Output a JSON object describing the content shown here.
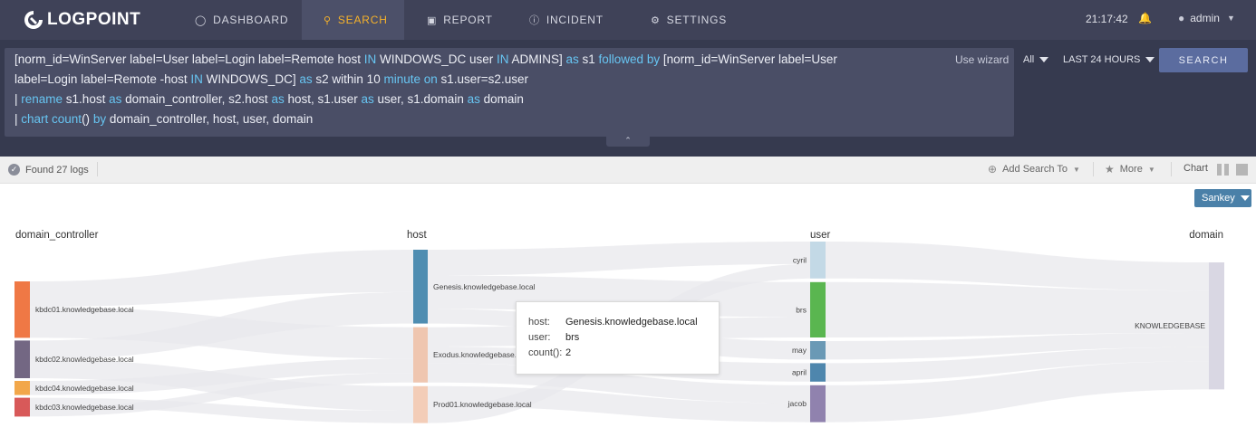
{
  "app": {
    "name": "LOGPOINT"
  },
  "nav": {
    "items": [
      {
        "label": "DASHBOARD",
        "icon": "dashboard-icon"
      },
      {
        "label": "SEARCH",
        "icon": "search-icon",
        "active": true
      },
      {
        "label": "REPORT",
        "icon": "report-icon"
      },
      {
        "label": "INCIDENT",
        "icon": "incident-icon"
      },
      {
        "label": "SETTINGS",
        "icon": "gear-icon"
      }
    ],
    "time": "21:17:42",
    "user": "admin"
  },
  "query": {
    "lines": [
      [
        [
          "[norm_id=WinServer label=User label=Login label=Remote host ",
          "t"
        ],
        [
          "IN",
          "k"
        ],
        [
          " WINDOWS_DC user ",
          "t"
        ],
        [
          "IN",
          "k"
        ],
        [
          " ADMINS] ",
          "t"
        ],
        [
          "as",
          "k"
        ],
        [
          " s1 ",
          "t"
        ],
        [
          "followed by",
          "k"
        ],
        [
          " [norm_id=WinServer label=User",
          "t"
        ]
      ],
      [
        [
          "label=Login label=Remote -host ",
          "t"
        ],
        [
          "IN",
          "k"
        ],
        [
          " WINDOWS_DC] ",
          "t"
        ],
        [
          "as",
          "k"
        ],
        [
          " s2 within 10 ",
          "t"
        ],
        [
          "minute",
          "k"
        ],
        [
          " ",
          "t"
        ],
        [
          "on",
          "k"
        ],
        [
          " s1.user=s2.user",
          "t"
        ]
      ],
      [
        [
          "| ",
          "t"
        ],
        [
          "rename",
          "k"
        ],
        [
          " s1.host ",
          "t"
        ],
        [
          "as",
          "k"
        ],
        [
          " domain_controller, s2.host ",
          "t"
        ],
        [
          "as",
          "k"
        ],
        [
          " host, s1.user ",
          "t"
        ],
        [
          "as",
          "k"
        ],
        [
          " user, s1.domain ",
          "t"
        ],
        [
          "as",
          "k"
        ],
        [
          " domain",
          "t"
        ]
      ],
      [
        [
          "| ",
          "t"
        ],
        [
          "chart count",
          "k"
        ],
        [
          "() ",
          "t"
        ],
        [
          "by",
          "k"
        ],
        [
          " domain_controller, host, user, domain",
          "t"
        ]
      ]
    ],
    "use_wizard": "Use wizard",
    "repo": "All",
    "time_range": "LAST 24 HOURS",
    "search_button": "SEARCH"
  },
  "results": {
    "found": "Found 27 logs",
    "add_search_to": "Add Search To",
    "more": "More",
    "chart_label": "Chart",
    "viz_type": "Sankey"
  },
  "chart_data": {
    "type": "sankey",
    "columns": [
      "domain_controller",
      "host",
      "user",
      "domain"
    ],
    "nodes": {
      "domain_controller": [
        {
          "name": "kbdc01.knowledgebase.local",
          "value": 12,
          "color": "#ef7845"
        },
        {
          "name": "kbdc02.knowledgebase.local",
          "value": 8,
          "color": "#736783"
        },
        {
          "name": "kbdc04.knowledgebase.local",
          "value": 3,
          "color": "#f2a74a"
        },
        {
          "name": "kbdc03.knowledgebase.local",
          "value": 4,
          "color": "#d85959"
        }
      ],
      "host": [
        {
          "name": "Genesis.knowledgebase.local",
          "value": 16,
          "color": "#4f8db1"
        },
        {
          "name": "Exodus.knowledgebase.local",
          "value": 12,
          "color": "#efc6b0"
        },
        {
          "name": "Prod01.knowledgebase.local",
          "value": 8,
          "color": "#f3cdb8"
        }
      ],
      "user": [
        {
          "name": "cyril",
          "value": 8,
          "color": "#c3d9e6"
        },
        {
          "name": "brs",
          "value": 12,
          "color": "#5ab650"
        },
        {
          "name": "may",
          "value": 4,
          "color": "#6a99b5"
        },
        {
          "name": "april",
          "value": 4,
          "color": "#4e86ad"
        },
        {
          "name": "jacob",
          "value": 8,
          "color": "#9082ae"
        }
      ],
      "domain": [
        {
          "name": "KNOWLEDGEBASE",
          "value": 27,
          "color": "#d9d7e3"
        }
      ]
    },
    "tooltip": {
      "host": "Genesis.knowledgebase.local",
      "user": "brs",
      "count": 2
    },
    "tooltip_keys": {
      "host": "host:",
      "user": "user:",
      "count": "count():"
    }
  }
}
